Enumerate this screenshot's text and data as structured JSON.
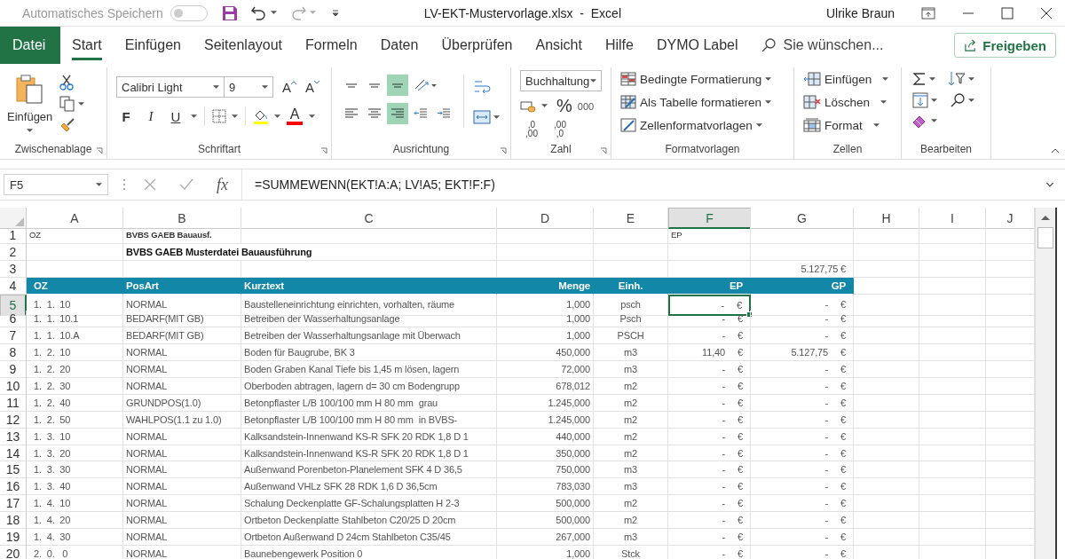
{
  "title_bar": {
    "autosave_label": "Automatisches Speichern",
    "autosave_on": false,
    "document_title": "LV-EKT-Mustervorlage.xlsx  -  Excel",
    "user": "Ulrike Braun"
  },
  "menu_tabs": [
    {
      "label": "Datei",
      "kind": "file",
      "selected": false
    },
    {
      "label": "Start",
      "kind": "tab",
      "selected": true
    },
    {
      "label": "Einfügen",
      "kind": "tab",
      "selected": false
    },
    {
      "label": "Seitenlayout",
      "kind": "tab",
      "selected": false
    },
    {
      "label": "Formeln",
      "kind": "tab",
      "selected": false
    },
    {
      "label": "Daten",
      "kind": "tab",
      "selected": false
    },
    {
      "label": "Überprüfen",
      "kind": "tab",
      "selected": false
    },
    {
      "label": "Ansicht",
      "kind": "tab",
      "selected": false
    },
    {
      "label": "Hilfe",
      "kind": "tab",
      "selected": false
    },
    {
      "label": "DYMO Label",
      "kind": "tab",
      "selected": false
    }
  ],
  "search": {
    "placeholder": "Sie wünschen..."
  },
  "share_button": "Freigeben",
  "ribbon": {
    "clipboard": {
      "paste_label": "Einfügen",
      "group_label": "Zwischenablage"
    },
    "font": {
      "family": "Calibri Light",
      "size": "9",
      "size_buttons": [
        "A",
        "A"
      ],
      "style_buttons": [
        "F",
        "I",
        "U"
      ],
      "text_color_letter": "A",
      "group_label": "Schriftart"
    },
    "alignment": {
      "rows": [
        [
          {
            "kind": "top",
            "selected": false
          },
          {
            "kind": "middle",
            "selected": false
          },
          {
            "kind": "bottom",
            "selected": true
          },
          {
            "kind": "orientation",
            "selected": false
          }
        ],
        [
          {
            "kind": "left",
            "selected": false
          },
          {
            "kind": "center",
            "selected": false
          },
          {
            "kind": "right",
            "selected": true
          },
          {
            "kind": "outdent",
            "selected": false
          },
          {
            "kind": "indent",
            "selected": false
          }
        ]
      ],
      "group_label": "Ausrichtung"
    },
    "number": {
      "format": "Buchhaltung",
      "symbols": [
        "%",
        "000"
      ],
      "decimal_buttons": [
        {
          "top": ",0",
          "bottom": ",00"
        },
        {
          "top": ",00",
          "bottom": ",0"
        }
      ],
      "group_label": "Zahl"
    },
    "styles": {
      "items": [
        {
          "kind": "conditional",
          "label": "Bedingte Formatierung"
        },
        {
          "kind": "table",
          "label": "Als Tabelle formatieren"
        },
        {
          "kind": "cellstyle",
          "label": "Zellenformatvorlagen"
        }
      ],
      "group_label": "Formatvorlagen"
    },
    "cells": {
      "items": [
        {
          "kind": "insert",
          "label": "Einfügen"
        },
        {
          "kind": "delete",
          "label": "Löschen"
        },
        {
          "kind": "format",
          "label": "Format"
        }
      ],
      "group_label": "Zellen"
    },
    "editing": {
      "group_label": "Bearbeiten"
    }
  },
  "formula_bar": {
    "name_box": "F5",
    "function_label": "fx",
    "formula": "=SUMMEWENN(EKT!A:A; LV!A5; EKT!F:F)"
  },
  "sheet": {
    "columns": [
      {
        "label": "A",
        "selected": false
      },
      {
        "label": "B",
        "selected": false
      },
      {
        "label": "C",
        "selected": false
      },
      {
        "label": "D",
        "selected": false
      },
      {
        "label": "E",
        "selected": false
      },
      {
        "label": "F",
        "selected": true
      },
      {
        "label": "G",
        "selected": false
      },
      {
        "label": "H",
        "selected": false
      },
      {
        "label": "I",
        "selected": false
      },
      {
        "label": "J",
        "selected": false
      }
    ],
    "rows": [
      {
        "number": "1",
        "kind": "info",
        "selected": false,
        "oz": "OZ",
        "posart": "BVBS GAEB Bauausf.",
        "ep": "EP"
      },
      {
        "number": "2",
        "kind": "title",
        "selected": false,
        "posart": "BVBS GAEB Musterdatei Bauausführung"
      },
      {
        "number": "3",
        "kind": "total",
        "selected": false,
        "gp": "5.127,75 €"
      },
      {
        "number": "4",
        "kind": "header",
        "selected": false,
        "oz": "OZ",
        "posart": "PosArt",
        "kurztext": "Kurztext",
        "menge": "Menge",
        "einheit": "Einh.",
        "ep": "EP",
        "gp": "GP"
      },
      {
        "number": "5",
        "kind": "item",
        "selected": true,
        "oz": "1.  1.  10",
        "posart": "NORMAL",
        "kurztext": "Baustelleneinrichtung einrichten, vorhalten, räume",
        "menge": "1,000",
        "einheit": "psch",
        "ep": {
          "amount": "-",
          "currency": "€"
        },
        "gp": {
          "amount": "-",
          "currency": "€"
        }
      },
      {
        "number": "6",
        "kind": "item",
        "selected": false,
        "oz": "1.  1.  10.1",
        "posart": "BEDARF(MIT GB)",
        "kurztext": "Betreiben der Wasserhaltungsanlage",
        "menge": "1,000",
        "einheit": "Psch",
        "ep": {
          "amount": "-",
          "currency": "€"
        },
        "gp": {
          "amount": "-",
          "currency": "€"
        }
      },
      {
        "number": "7",
        "kind": "item",
        "selected": false,
        "oz": "1.  1.  10.A",
        "posart": "BEDARF(MIT GB)",
        "kurztext": "Betreiben der Wasserhaltungsanlage mit Überwach",
        "menge": "1,000",
        "einheit": "PSCH",
        "ep": {
          "amount": "-",
          "currency": "€"
        },
        "gp": {
          "amount": "-",
          "currency": "€"
        }
      },
      {
        "number": "8",
        "kind": "item",
        "selected": false,
        "oz": "1.  2.  10",
        "posart": "NORMAL",
        "kurztext": "Boden für Baugrube, BK 3",
        "menge": "450,000",
        "einheit": "m3",
        "ep": {
          "amount": "11,40",
          "currency": "€"
        },
        "gp": {
          "amount": "5.127,75",
          "currency": "€"
        }
      },
      {
        "number": "9",
        "kind": "item",
        "selected": false,
        "oz": "1.  2.  20",
        "posart": "NORMAL",
        "kurztext": "Boden Graben Kanal Tiefe bis 1,45 m lösen, lagern",
        "menge": "72,000",
        "einheit": "m3",
        "ep": {
          "amount": "-",
          "currency": "€"
        },
        "gp": {
          "amount": "-",
          "currency": "€"
        }
      },
      {
        "number": "10",
        "kind": "item",
        "selected": false,
        "oz": "1.  2.  30",
        "posart": "NORMAL",
        "kurztext": "Oberboden abtragen, lagern d= 30 cm Bodengrupp",
        "menge": "678,012",
        "einheit": "m2",
        "ep": {
          "amount": "-",
          "currency": "€"
        },
        "gp": {
          "amount": "-",
          "currency": "€"
        }
      },
      {
        "number": "11",
        "kind": "item",
        "selected": false,
        "oz": "1.  2.  40",
        "posart": "GRUNDPOS(1.0)",
        "kurztext": "Betonpflaster L/B 100/100 mm H 80 mm  grau",
        "menge": "1.245,000",
        "einheit": "m2",
        "ep": {
          "amount": "-",
          "currency": "€"
        },
        "gp": {
          "amount": "-",
          "currency": "€"
        }
      },
      {
        "number": "12",
        "kind": "item",
        "selected": false,
        "oz": "1.  2.  50",
        "posart": "WAHLPOS(1.1 zu 1.0)",
        "kurztext": "Betonpflaster L/B 100/100 mm H 80 mm  in BVBS-",
        "menge": "1.245,000",
        "einheit": "m2",
        "ep": {
          "amount": "-",
          "currency": "€"
        },
        "gp": {
          "amount": "-",
          "currency": "€"
        }
      },
      {
        "number": "13",
        "kind": "item",
        "selected": false,
        "oz": "1.  3.  10",
        "posart": "NORMAL",
        "kurztext": "Kalksandstein-Innenwand KS-R SFK 20 RDK 1,8 D 1",
        "menge": "440,000",
        "einheit": "m2",
        "ep": {
          "amount": "-",
          "currency": "€"
        },
        "gp": {
          "amount": "-",
          "currency": "€"
        }
      },
      {
        "number": "14",
        "kind": "item",
        "selected": false,
        "oz": "1.  3.  20",
        "posart": "NORMAL",
        "kurztext": "Kalksandstein-Innenwand KS-R SFK 20 RDK 1,8 D 1",
        "menge": "350,000",
        "einheit": "m2",
        "ep": {
          "amount": "-",
          "currency": "€"
        },
        "gp": {
          "amount": "-",
          "currency": "€"
        }
      },
      {
        "number": "15",
        "kind": "item",
        "selected": false,
        "oz": "1.  3.  30",
        "posart": "NORMAL",
        "kurztext": "Außenwand Porenbeton-Planelement SFK 4 D 36,5",
        "menge": "750,000",
        "einheit": "m3",
        "ep": {
          "amount": "-",
          "currency": "€"
        },
        "gp": {
          "amount": "-",
          "currency": "€"
        }
      },
      {
        "number": "16",
        "kind": "item",
        "selected": false,
        "oz": "1.  3.  40",
        "posart": "NORMAL",
        "kurztext": "Außenwand VHLz SFK 28 RDK 1,6 D 36,5cm",
        "menge": "783,030",
        "einheit": "m3",
        "ep": {
          "amount": "-",
          "currency": "€"
        },
        "gp": {
          "amount": "-",
          "currency": "€"
        }
      },
      {
        "number": "17",
        "kind": "item",
        "selected": false,
        "oz": "1.  4.  10",
        "posart": "NORMAL",
        "kurztext": "Schalung Deckenplatte GF-Schalungsplatten H 2-3",
        "menge": "500,000",
        "einheit": "m2",
        "ep": {
          "amount": "-",
          "currency": "€"
        },
        "gp": {
          "amount": "-",
          "currency": "€"
        }
      },
      {
        "number": "18",
        "kind": "item",
        "selected": false,
        "oz": "1.  4.  20",
        "posart": "NORMAL",
        "kurztext": "Ortbeton Deckenplatte Stahlbeton C20/25 D 20cm",
        "menge": "500,000",
        "einheit": "m2",
        "ep": {
          "amount": "-",
          "currency": "€"
        },
        "gp": {
          "amount": "-",
          "currency": "€"
        }
      },
      {
        "number": "19",
        "kind": "item",
        "selected": false,
        "oz": "1.  4.  30",
        "posart": "NORMAL",
        "kurztext": "Ortbeton Außenwand D 24cm Stahlbeton C35/45",
        "menge": "267,000",
        "einheit": "m3",
        "ep": {
          "amount": "-",
          "currency": "€"
        },
        "gp": {
          "amount": "-",
          "currency": "€"
        }
      },
      {
        "number": "20",
        "kind": "item",
        "selected": false,
        "oz": "2.  0.   0",
        "posart": "NORMAL",
        "kurztext": "Baunebengewerk Position 0",
        "menge": "1,000",
        "einheit": "Stck",
        "ep": {
          "amount": "-",
          "currency": "€"
        },
        "gp": {
          "amount": "-",
          "currency": "€"
        }
      }
    ]
  }
}
